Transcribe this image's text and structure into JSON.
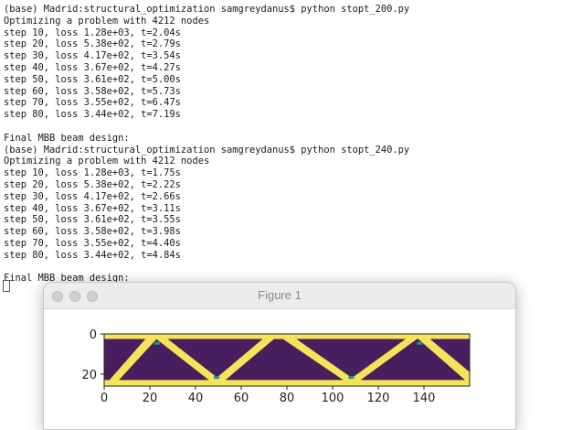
{
  "terminal": {
    "lines": [
      "(base) Madrid:structural_optimization samgreydanus$ python stopt_200.py",
      "Optimizing a problem with 4212 nodes",
      "step 10, loss 1.28e+03, t=2.04s",
      "step 20, loss 5.38e+02, t=2.79s",
      "step 30, loss 4.17e+02, t=3.54s",
      "step 40, loss 3.67e+02, t=4.27s",
      "step 50, loss 3.61e+02, t=5.00s",
      "step 60, loss 3.58e+02, t=5.73s",
      "step 70, loss 3.55e+02, t=6.47s",
      "step 80, loss 3.44e+02, t=7.19s",
      "",
      "Final MBB beam design:",
      "(base) Madrid:structural_optimization samgreydanus$ python stopt_240.py",
      "Optimizing a problem with 4212 nodes",
      "step 10, loss 1.28e+03, t=1.75s",
      "step 20, loss 5.38e+02, t=2.22s",
      "step 30, loss 4.17e+02, t=2.66s",
      "step 40, loss 3.67e+02, t=3.11s",
      "step 50, loss 3.61e+02, t=3.55s",
      "step 60, loss 3.58e+02, t=3.98s",
      "step 70, loss 3.55e+02, t=4.40s",
      "step 80, loss 3.44e+02, t=4.84s",
      "",
      "Final MBB beam design:"
    ]
  },
  "figure_window": {
    "title": "Figure 1",
    "buttons": [
      "close-button",
      "minimize-button",
      "zoom-button"
    ]
  },
  "chart_data": {
    "type": "heatmap",
    "xlim": [
      0,
      160
    ],
    "ylim": [
      26,
      0
    ],
    "x_ticks": [
      "0",
      "20",
      "40",
      "60",
      "80",
      "100",
      "120",
      "140"
    ],
    "y_ticks": [
      "0",
      "20"
    ],
    "grid": false,
    "colors": {
      "solid": "#f5e45a",
      "void": "#471f5f",
      "edge": "#2a8f8a"
    }
  }
}
